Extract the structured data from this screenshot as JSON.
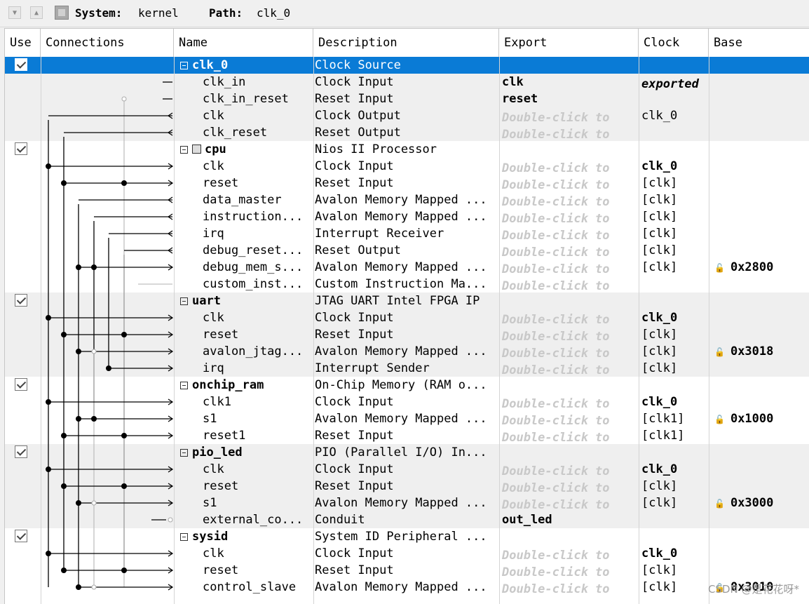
{
  "toolbar": {
    "system_label": "System:",
    "system_value": "kernel",
    "path_label": "Path:",
    "path_value": "clk_0"
  },
  "columns": [
    "Use",
    "Connections",
    "Name",
    "Description",
    "Export",
    "Clock",
    "Base"
  ],
  "rows": [
    {
      "checkbox": true,
      "name": "clk_0",
      "desc": "Clock Source",
      "export": "",
      "clock": "",
      "base": "",
      "group": true,
      "selected": true
    },
    {
      "name": "clk_in",
      "desc": "Clock Input",
      "export": "clk",
      "clock": "exported",
      "base": ""
    },
    {
      "name": "clk_in_reset",
      "desc": "Reset Input",
      "export": "reset",
      "clock": "",
      "base": ""
    },
    {
      "name": "clk",
      "desc": "Clock Output",
      "export": "Double-click to",
      "clock": "clk_0",
      "base": ""
    },
    {
      "name": "clk_reset",
      "desc": "Reset Output",
      "export": "Double-click to",
      "clock": "",
      "base": ""
    },
    {
      "checkbox": true,
      "name": "cpu",
      "desc": "Nios II Processor",
      "export": "",
      "clock": "",
      "base": "",
      "group": true
    },
    {
      "name": "clk",
      "desc": "Clock Input",
      "export": "Double-click to",
      "clock": "clk_0",
      "base": ""
    },
    {
      "name": "reset",
      "desc": "Reset Input",
      "export": "Double-click to",
      "clock": "[clk]",
      "base": ""
    },
    {
      "name": "data_master",
      "desc": "Avalon Memory Mapped ...",
      "export": "Double-click to",
      "clock": "[clk]",
      "base": ""
    },
    {
      "name": "instruction...",
      "desc": "Avalon Memory Mapped ...",
      "export": "Double-click to",
      "clock": "[clk]",
      "base": ""
    },
    {
      "name": "irq",
      "desc": "Interrupt Receiver",
      "export": "Double-click to",
      "clock": "[clk]",
      "base": ""
    },
    {
      "name": "debug_reset...",
      "desc": "Reset Output",
      "export": "Double-click to",
      "clock": "[clk]",
      "base": ""
    },
    {
      "name": "debug_mem_s...",
      "desc": "Avalon Memory Mapped ...",
      "export": "Double-click to",
      "clock": "[clk]",
      "base": "0x2800"
    },
    {
      "name": "custom_inst...",
      "desc": "Custom Instruction Ma...",
      "export": "Double-click to",
      "clock": "",
      "base": ""
    },
    {
      "checkbox": true,
      "name": "uart",
      "desc": "JTAG UART Intel FPGA IP",
      "export": "",
      "clock": "",
      "base": "",
      "group": true
    },
    {
      "name": "clk",
      "desc": "Clock Input",
      "export": "Double-click to",
      "clock": "clk_0",
      "base": ""
    },
    {
      "name": "reset",
      "desc": "Reset Input",
      "export": "Double-click to",
      "clock": "[clk]",
      "base": ""
    },
    {
      "name": "avalon_jtag...",
      "desc": "Avalon Memory Mapped ...",
      "export": "Double-click to",
      "clock": "[clk]",
      "base": "0x3018"
    },
    {
      "name": "irq",
      "desc": "Interrupt Sender",
      "export": "Double-click to",
      "clock": "[clk]",
      "base": ""
    },
    {
      "checkbox": true,
      "name": "onchip_ram",
      "desc": "On-Chip Memory (RAM o...",
      "export": "",
      "clock": "",
      "base": "",
      "group": true
    },
    {
      "name": "clk1",
      "desc": "Clock Input",
      "export": "Double-click to",
      "clock": "clk_0",
      "base": ""
    },
    {
      "name": "s1",
      "desc": "Avalon Memory Mapped ...",
      "export": "Double-click to",
      "clock": "[clk1]",
      "base": "0x1000"
    },
    {
      "name": "reset1",
      "desc": "Reset Input",
      "export": "Double-click to",
      "clock": "[clk1]",
      "base": ""
    },
    {
      "checkbox": true,
      "name": "pio_led",
      "desc": "PIO (Parallel I/O) In...",
      "export": "",
      "clock": "",
      "base": "",
      "group": true
    },
    {
      "name": "clk",
      "desc": "Clock Input",
      "export": "Double-click to",
      "clock": "clk_0",
      "base": ""
    },
    {
      "name": "reset",
      "desc": "Reset Input",
      "export": "Double-click to",
      "clock": "[clk]",
      "base": ""
    },
    {
      "name": "s1",
      "desc": "Avalon Memory Mapped ...",
      "export": "Double-click to",
      "clock": "[clk]",
      "base": "0x3000"
    },
    {
      "name": "external_co...",
      "desc": "Conduit",
      "export": "out_led",
      "clock": "",
      "base": ""
    },
    {
      "checkbox": true,
      "name": "sysid",
      "desc": "System ID Peripheral ...",
      "export": "",
      "clock": "",
      "base": "",
      "group": true
    },
    {
      "name": "clk",
      "desc": "Clock Input",
      "export": "Double-click to",
      "clock": "clk_0",
      "base": ""
    },
    {
      "name": "reset",
      "desc": "Reset Input",
      "export": "Double-click to",
      "clock": "[clk]",
      "base": ""
    },
    {
      "name": "control_slave",
      "desc": "Avalon Memory Mapped ...",
      "export": "Double-click to",
      "clock": "[clk]",
      "base": "0x3010"
    }
  ],
  "watermark": "CSDN @是花花呀*"
}
